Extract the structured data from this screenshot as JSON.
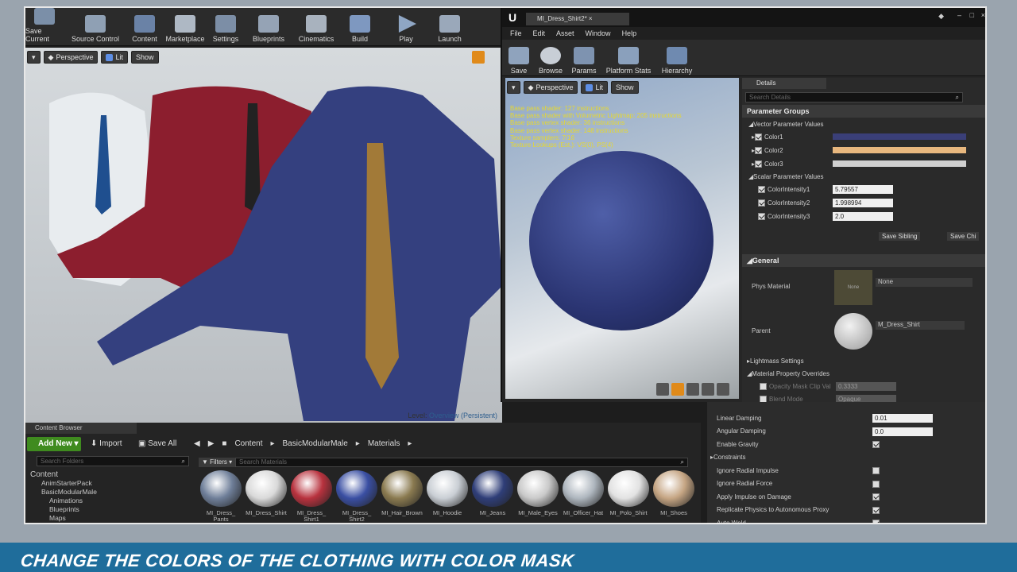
{
  "toolbar": {
    "items": [
      "Save Current",
      "Source Control",
      "Content",
      "Marketplace",
      "Settings",
      "Blueprints",
      "Cinematics",
      "Build",
      "Play",
      "Launch"
    ]
  },
  "viewport": {
    "perspective": "Perspective",
    "lit": "Lit",
    "show": "Show",
    "level_label": "Level:",
    "level_name": "Overview (Persistent)"
  },
  "material_window": {
    "tab": "MI_Dress_Shirt2*",
    "menu": [
      "File",
      "Edit",
      "Asset",
      "Window",
      "Help"
    ],
    "tools": [
      "Save",
      "Browse",
      "Params",
      "Platform Stats",
      "Hierarchy"
    ],
    "viewport": {
      "perspective": "Perspective",
      "lit": "Lit",
      "show": "Show"
    },
    "stats": [
      "Base pass shader: 127 instructions",
      "Base pass shader with Volumetric Lightmap: 205 instructions",
      "Base pass vertex shader: 36 instructions",
      "Base pass vertex shader: 148 instructions",
      "Texture samplers: 7/16",
      "Texture Lookups (Est.): VS(0), PS(4)"
    ]
  },
  "details": {
    "tab": "Details",
    "search_placeholder": "Search Details",
    "parameter_groups": "Parameter Groups",
    "vector_params": "Vector Parameter Values",
    "colors": [
      {
        "label": "Color1",
        "swatch": "#3a3f78"
      },
      {
        "label": "Color2",
        "swatch": "#e8b77e"
      },
      {
        "label": "Color3",
        "swatch": "#cfcfcf"
      }
    ],
    "scalar_params": "Scalar Parameter Values",
    "scalars": [
      {
        "label": "ColorIntensity1",
        "value": "5.79557"
      },
      {
        "label": "ColorIntensity2",
        "value": "1.998994"
      },
      {
        "label": "ColorIntensity3",
        "value": "2.0"
      }
    ],
    "save_sibling": "Save Sibling",
    "save_child": "Save Chi",
    "general": "General",
    "phys_material": "Phys Material",
    "phys_thumb": "None",
    "phys_value": "None",
    "parent": "Parent",
    "parent_value": "M_Dress_Shirt",
    "lightmass": "Lightmass Settings",
    "mat_override": "Material Property Overrides",
    "opacity_clip": "Opacity Mask Clip Val",
    "opacity_value": "0.3333",
    "blend_mode": "Blend Mode",
    "blend_value": "Opaque"
  },
  "physics": {
    "rows": [
      {
        "label": "Linear Damping",
        "value": "0.01",
        "type": "num"
      },
      {
        "label": "Angular Damping",
        "value": "0.0",
        "type": "num"
      },
      {
        "label": "Enable Gravity",
        "type": "chk",
        "checked": true
      },
      {
        "label": "Constraints",
        "type": "section"
      },
      {
        "label": "Ignore Radial Impulse",
        "type": "chk",
        "checked": false
      },
      {
        "label": "Ignore Radial Force",
        "type": "chk",
        "checked": false
      },
      {
        "label": "Apply Impulse on Damage",
        "type": "chk",
        "checked": true
      },
      {
        "label": "Replicate Physics to Autonomous Proxy",
        "type": "chk",
        "checked": true
      },
      {
        "label": "Auto Weld",
        "type": "chk",
        "checked": true
      }
    ]
  },
  "content_browser": {
    "tab": "Content Browser",
    "add_new": "Add New",
    "import": "Import",
    "save_all": "Save All",
    "path": [
      "Content",
      "BasicModularMale",
      "Materials"
    ],
    "search_folders": "Search Folders",
    "filters": "Filters",
    "search_materials": "Search Materials",
    "folders": [
      "Content",
      "AnimStarterPack",
      "BasicModularMale",
      "Animations",
      "Blueprints",
      "Maps"
    ],
    "assets": [
      {
        "name": "MI_Dress_\nPants",
        "color": "#6f7f99"
      },
      {
        "name": "MI_Dress_Shirt",
        "color": "#d9d9d9"
      },
      {
        "name": "MI_Dress_\nShirt1",
        "color": "#b8323e"
      },
      {
        "name": "MI_Dress_\nShirt2",
        "color": "#3a4fa3"
      },
      {
        "name": "MI_Hair_Brown",
        "color": "#8a7a50"
      },
      {
        "name": "MI_Hoodie",
        "color": "#c9ced4"
      },
      {
        "name": "MI_Jeans",
        "color": "#2f3e78"
      },
      {
        "name": "MI_Male_Eyes",
        "color": "#c9c9c9"
      },
      {
        "name": "MI_Officer_Hat",
        "color": "#aeb6be"
      },
      {
        "name": "MI_Polo_Shirt",
        "color": "#e2e2e2"
      },
      {
        "name": "MI_Shoes",
        "color": "#c5a583"
      }
    ]
  },
  "banner": "CHANGE THE COLORS OF THE CLOTHING WITH COLOR MASK"
}
